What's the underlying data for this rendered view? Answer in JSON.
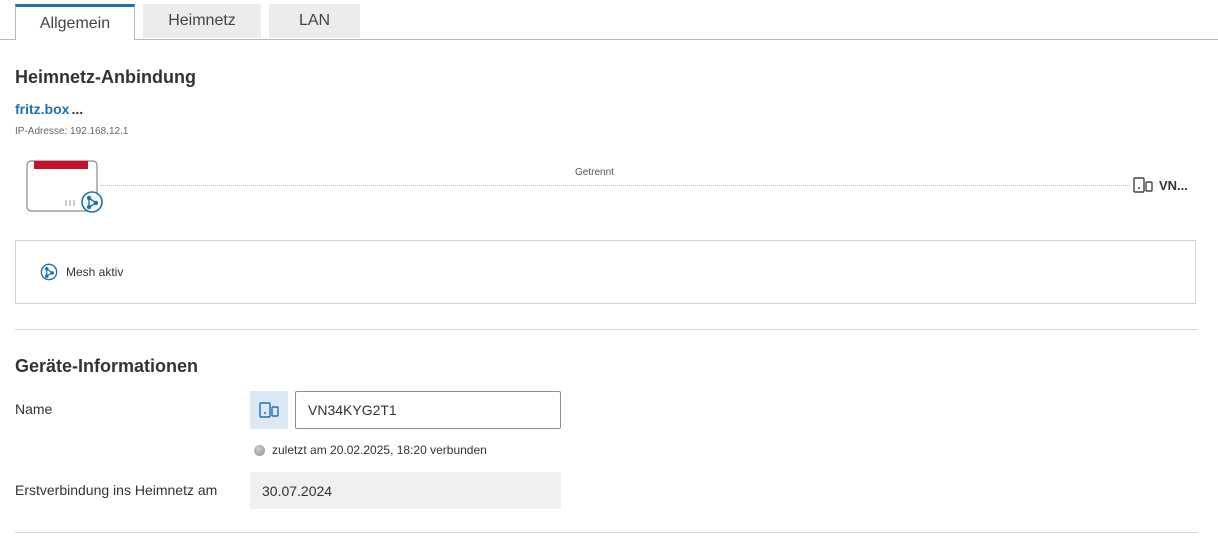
{
  "tabs": [
    {
      "label": "Allgemein",
      "active": true
    },
    {
      "label": "Heimnetz",
      "active": false
    },
    {
      "label": "LAN",
      "active": false
    }
  ],
  "connection": {
    "title": "Heimnetz-Anbindung",
    "host": "fritz.box",
    "host_suffix": "...",
    "ip_label": "IP-Adresse: 192.168.12.1",
    "status": "Getrennt",
    "remote_device": "VN...",
    "router_icon": "router-icon",
    "mesh_icon": "mesh-icon",
    "device_icon": "device-icon"
  },
  "mesh": {
    "label": "Mesh aktiv"
  },
  "device_info": {
    "title": "Geräte-Informationen",
    "name_label": "Name",
    "name_value": "VN34KYG2T1",
    "last_connected": "zuletzt am 20.02.2025, 18:20 verbunden",
    "first_connection_label": "Erstverbindung ins Heimnetz am",
    "first_connection_value": "30.07.2024"
  },
  "colors": {
    "accent": "#1f6fb2",
    "router_red": "#c7112a",
    "chip_bg": "#dce9f5"
  }
}
